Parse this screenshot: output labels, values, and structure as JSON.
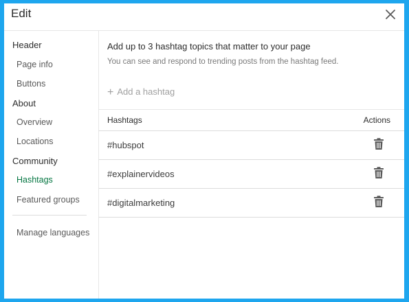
{
  "dialog": {
    "title": "Edit",
    "close_icon": "close-icon"
  },
  "sidebar": {
    "sections": [
      {
        "label": "Header",
        "items": [
          "Page info",
          "Buttons"
        ]
      },
      {
        "label": "About",
        "items": [
          "Overview",
          "Locations"
        ]
      },
      {
        "label": "Community",
        "items": [
          "Hashtags",
          "Featured groups"
        ]
      }
    ],
    "active_item": "Hashtags",
    "manage_languages": "Manage languages"
  },
  "main": {
    "intro_title": "Add up to 3 hashtag topics that matter to your page",
    "intro_subtitle": "You can see and respond to trending posts from the hashtag feed.",
    "add_label": "Add a hashtag",
    "table": {
      "col_hashtags": "Hashtags",
      "col_actions": "Actions",
      "rows": [
        {
          "tag": "#hubspot",
          "action_icon": "trash-icon"
        },
        {
          "tag": "#explainervideos",
          "action_icon": "trash-icon"
        },
        {
          "tag": "#digitalmarketing",
          "action_icon": "trash-icon"
        }
      ]
    }
  },
  "colors": {
    "frame": "#1ea6ee",
    "active": "#057642"
  }
}
